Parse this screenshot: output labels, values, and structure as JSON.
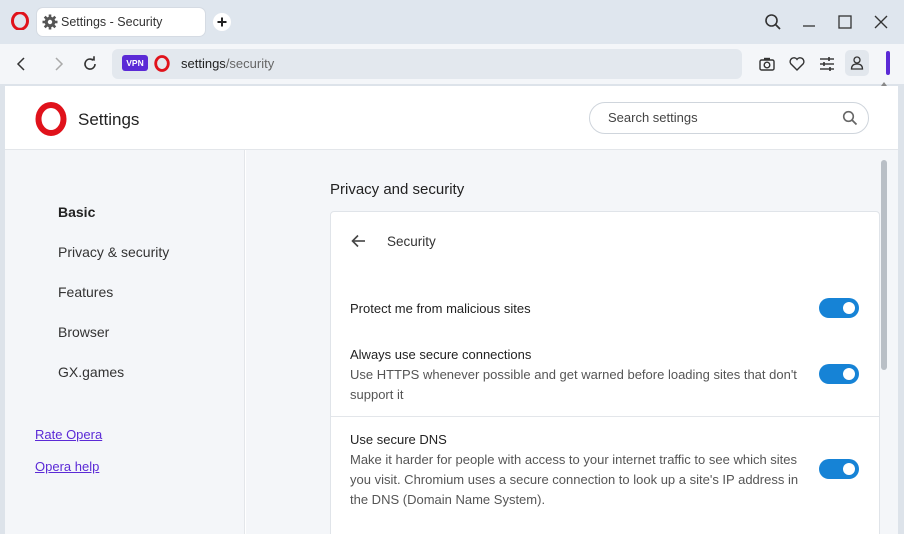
{
  "window": {
    "tab_title": "Settings - Security",
    "new_tab_label": "+",
    "controls": [
      "search-icon",
      "minimize-icon",
      "maximize-icon",
      "close-icon"
    ]
  },
  "addressbar": {
    "vpn_label": "VPN",
    "url_host": "settings",
    "url_path": "/security",
    "tools": [
      "camera-icon",
      "heart-icon",
      "easy-setup-icon",
      "profile-icon"
    ]
  },
  "colors": {
    "accent": "#5b2ad6",
    "toggle_on": "#1683d6",
    "opera_red": "#e0121b"
  },
  "header": {
    "title": "Settings",
    "search_placeholder": "Search settings"
  },
  "sidebar": {
    "items": [
      {
        "label": "Basic",
        "active": true
      },
      {
        "label": "Privacy & security",
        "active": false
      },
      {
        "label": "Features",
        "active": false
      },
      {
        "label": "Browser",
        "active": false
      },
      {
        "label": "GX.games",
        "active": false
      }
    ],
    "links": [
      {
        "label": "Rate Opera"
      },
      {
        "label": "Opera help"
      }
    ]
  },
  "main": {
    "section_title": "Privacy and security",
    "card_title": "Security",
    "rows": [
      {
        "title": "Protect me from malicious sites",
        "description": "",
        "enabled": true
      },
      {
        "title": "Always use secure connections",
        "description": "Use HTTPS whenever possible and get warned before loading sites that don't support it",
        "enabled": true
      },
      {
        "title": "Use secure DNS",
        "description": "Make it harder for people with access to your internet traffic to see which sites you visit. Chromium uses a secure connection to look up a site's IP address in the DNS (Domain Name System).",
        "enabled": true
      }
    ]
  }
}
